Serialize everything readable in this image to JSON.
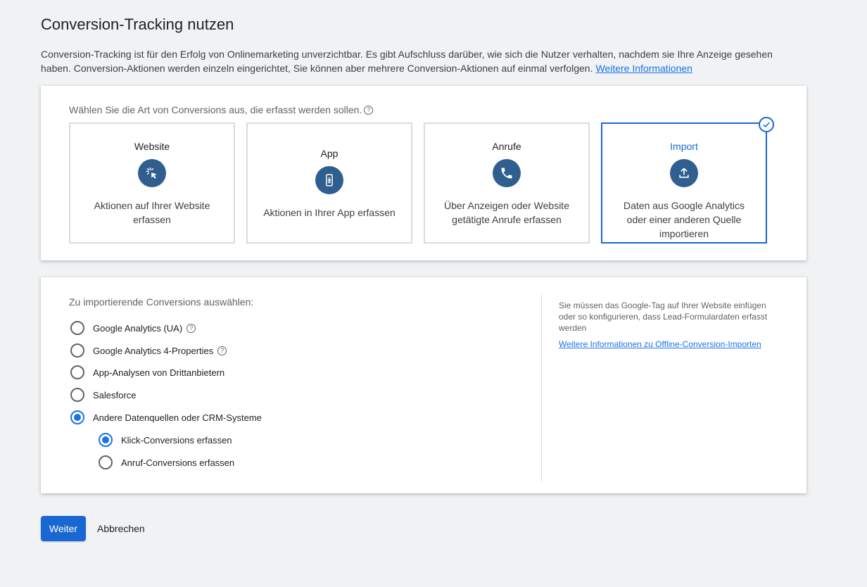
{
  "header": {
    "title": "Conversion-Tracking nutzen",
    "intro": "Conversion-Tracking ist für den Erfolg von Onlinemarketing unverzichtbar. Es gibt Aufschluss darüber, wie sich die Nutzer verhalten, nachdem sie Ihre Anzeige gesehen haben. Conversion-Aktionen werden einzeln eingerichtet, Sie können aber mehrere Conversion-Aktionen auf einmal verfolgen.",
    "link": "Weitere Informationen"
  },
  "types": {
    "label": "Wählen Sie die Art von Conversions aus, die erfasst werden sollen.",
    "help": "?",
    "tiles": [
      {
        "title": "Website",
        "desc": "Aktionen auf Ihrer Website erfassen",
        "icon": "cursor-click-icon"
      },
      {
        "title": "App",
        "desc": "Aktionen in Ihrer App erfassen",
        "icon": "phone-download-icon"
      },
      {
        "title": "Anrufe",
        "desc": "Über Anzeigen oder Website getätigte Anrufe erfassen",
        "icon": "phone-call-icon"
      },
      {
        "title": "Import",
        "desc": "Daten aus Google Analytics oder einer anderen Quelle importieren",
        "icon": "upload-icon"
      }
    ],
    "selected": "Import"
  },
  "import": {
    "label": "Zu importierende Conversions auswählen:",
    "options": [
      {
        "label": "Google Analytics (UA)",
        "checked": false,
        "help": "?"
      },
      {
        "label": "Google Analytics 4-Properties",
        "checked": false,
        "help": "?"
      },
      {
        "label": "App-Analysen von Drittanbietern",
        "checked": false
      },
      {
        "label": "Salesforce",
        "checked": false
      },
      {
        "label": "Andere Datenquellen oder CRM-Systeme",
        "checked": true
      }
    ],
    "suboptions": [
      {
        "label": "Klick-Conversions erfassen",
        "checked": true
      },
      {
        "label": "Anruf-Conversions erfassen",
        "checked": false
      }
    ],
    "side_text": "Sie müssen das Google-Tag auf Ihrer Website einfügen oder so konfigurieren, dass Lead-Formulardaten erfasst werden",
    "side_link": "Weitere Informationen zu Offline-Conversion-Importen"
  },
  "actions": {
    "next": "Weiter",
    "cancel": "Abbrechen"
  },
  "colors": {
    "accent": "#1967d2",
    "icon_bg": "#2f5e8f",
    "page_bg": "#f1f2f4"
  }
}
